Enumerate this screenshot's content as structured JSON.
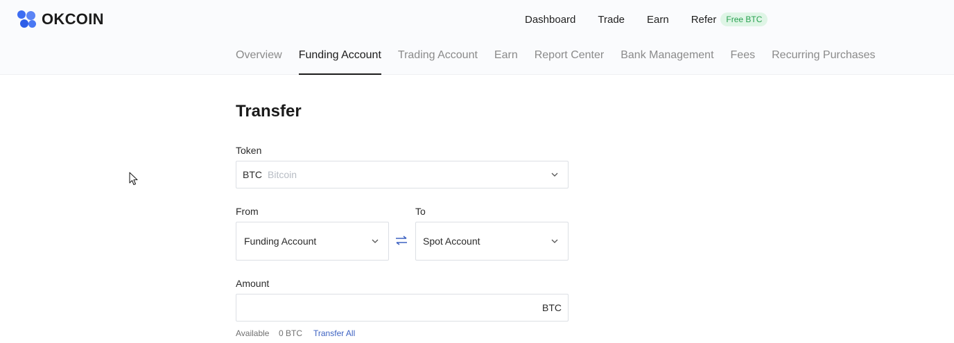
{
  "brand": {
    "name": "OKCOIN"
  },
  "top_nav": {
    "items": [
      "Dashboard",
      "Trade",
      "Earn"
    ],
    "refer_label": "Refer",
    "refer_badge": "Free BTC"
  },
  "sub_nav": {
    "tabs": [
      "Overview",
      "Funding Account",
      "Trading Account",
      "Earn",
      "Report Center",
      "Bank Management",
      "Fees",
      "Recurring Purchases"
    ],
    "active": "Funding Account"
  },
  "transfer": {
    "title": "Transfer",
    "token_label": "Token",
    "token_symbol": "BTC",
    "token_name": "Bitcoin",
    "from_label": "From",
    "from_value": "Funding Account",
    "to_label": "To",
    "to_value": "Spot Account",
    "amount_label": "Amount",
    "amount_value": "",
    "amount_unit": "BTC",
    "available_label": "Available",
    "available_value": "0 BTC",
    "transfer_all_label": "Transfer All"
  },
  "colors": {
    "accent": "#3d6df2",
    "badge_bg": "#dff5e6",
    "badge_text": "#27a04f",
    "link": "#3d62c2"
  }
}
